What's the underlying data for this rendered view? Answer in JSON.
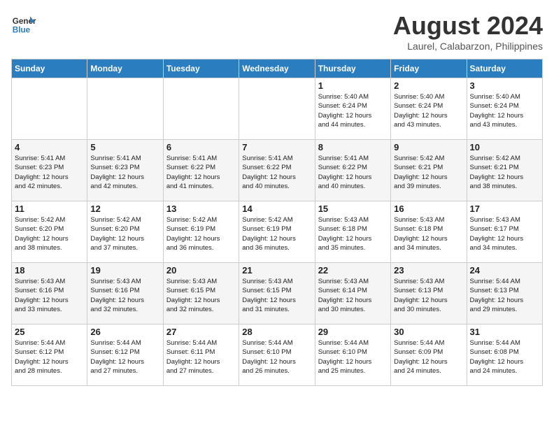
{
  "header": {
    "logo_line1": "General",
    "logo_line2": "Blue",
    "month_year": "August 2024",
    "location": "Laurel, Calabarzon, Philippines"
  },
  "weekdays": [
    "Sunday",
    "Monday",
    "Tuesday",
    "Wednesday",
    "Thursday",
    "Friday",
    "Saturday"
  ],
  "weeks": [
    [
      {
        "day": "",
        "info": ""
      },
      {
        "day": "",
        "info": ""
      },
      {
        "day": "",
        "info": ""
      },
      {
        "day": "",
        "info": ""
      },
      {
        "day": "1",
        "info": "Sunrise: 5:40 AM\nSunset: 6:24 PM\nDaylight: 12 hours\nand 44 minutes."
      },
      {
        "day": "2",
        "info": "Sunrise: 5:40 AM\nSunset: 6:24 PM\nDaylight: 12 hours\nand 43 minutes."
      },
      {
        "day": "3",
        "info": "Sunrise: 5:40 AM\nSunset: 6:24 PM\nDaylight: 12 hours\nand 43 minutes."
      }
    ],
    [
      {
        "day": "4",
        "info": "Sunrise: 5:41 AM\nSunset: 6:23 PM\nDaylight: 12 hours\nand 42 minutes."
      },
      {
        "day": "5",
        "info": "Sunrise: 5:41 AM\nSunset: 6:23 PM\nDaylight: 12 hours\nand 42 minutes."
      },
      {
        "day": "6",
        "info": "Sunrise: 5:41 AM\nSunset: 6:22 PM\nDaylight: 12 hours\nand 41 minutes."
      },
      {
        "day": "7",
        "info": "Sunrise: 5:41 AM\nSunset: 6:22 PM\nDaylight: 12 hours\nand 40 minutes."
      },
      {
        "day": "8",
        "info": "Sunrise: 5:41 AM\nSunset: 6:22 PM\nDaylight: 12 hours\nand 40 minutes."
      },
      {
        "day": "9",
        "info": "Sunrise: 5:42 AM\nSunset: 6:21 PM\nDaylight: 12 hours\nand 39 minutes."
      },
      {
        "day": "10",
        "info": "Sunrise: 5:42 AM\nSunset: 6:21 PM\nDaylight: 12 hours\nand 38 minutes."
      }
    ],
    [
      {
        "day": "11",
        "info": "Sunrise: 5:42 AM\nSunset: 6:20 PM\nDaylight: 12 hours\nand 38 minutes."
      },
      {
        "day": "12",
        "info": "Sunrise: 5:42 AM\nSunset: 6:20 PM\nDaylight: 12 hours\nand 37 minutes."
      },
      {
        "day": "13",
        "info": "Sunrise: 5:42 AM\nSunset: 6:19 PM\nDaylight: 12 hours\nand 36 minutes."
      },
      {
        "day": "14",
        "info": "Sunrise: 5:42 AM\nSunset: 6:19 PM\nDaylight: 12 hours\nand 36 minutes."
      },
      {
        "day": "15",
        "info": "Sunrise: 5:43 AM\nSunset: 6:18 PM\nDaylight: 12 hours\nand 35 minutes."
      },
      {
        "day": "16",
        "info": "Sunrise: 5:43 AM\nSunset: 6:18 PM\nDaylight: 12 hours\nand 34 minutes."
      },
      {
        "day": "17",
        "info": "Sunrise: 5:43 AM\nSunset: 6:17 PM\nDaylight: 12 hours\nand 34 minutes."
      }
    ],
    [
      {
        "day": "18",
        "info": "Sunrise: 5:43 AM\nSunset: 6:16 PM\nDaylight: 12 hours\nand 33 minutes."
      },
      {
        "day": "19",
        "info": "Sunrise: 5:43 AM\nSunset: 6:16 PM\nDaylight: 12 hours\nand 32 minutes."
      },
      {
        "day": "20",
        "info": "Sunrise: 5:43 AM\nSunset: 6:15 PM\nDaylight: 12 hours\nand 32 minutes."
      },
      {
        "day": "21",
        "info": "Sunrise: 5:43 AM\nSunset: 6:15 PM\nDaylight: 12 hours\nand 31 minutes."
      },
      {
        "day": "22",
        "info": "Sunrise: 5:43 AM\nSunset: 6:14 PM\nDaylight: 12 hours\nand 30 minutes."
      },
      {
        "day": "23",
        "info": "Sunrise: 5:43 AM\nSunset: 6:13 PM\nDaylight: 12 hours\nand 30 minutes."
      },
      {
        "day": "24",
        "info": "Sunrise: 5:44 AM\nSunset: 6:13 PM\nDaylight: 12 hours\nand 29 minutes."
      }
    ],
    [
      {
        "day": "25",
        "info": "Sunrise: 5:44 AM\nSunset: 6:12 PM\nDaylight: 12 hours\nand 28 minutes."
      },
      {
        "day": "26",
        "info": "Sunrise: 5:44 AM\nSunset: 6:12 PM\nDaylight: 12 hours\nand 27 minutes."
      },
      {
        "day": "27",
        "info": "Sunrise: 5:44 AM\nSunset: 6:11 PM\nDaylight: 12 hours\nand 27 minutes."
      },
      {
        "day": "28",
        "info": "Sunrise: 5:44 AM\nSunset: 6:10 PM\nDaylight: 12 hours\nand 26 minutes."
      },
      {
        "day": "29",
        "info": "Sunrise: 5:44 AM\nSunset: 6:10 PM\nDaylight: 12 hours\nand 25 minutes."
      },
      {
        "day": "30",
        "info": "Sunrise: 5:44 AM\nSunset: 6:09 PM\nDaylight: 12 hours\nand 24 minutes."
      },
      {
        "day": "31",
        "info": "Sunrise: 5:44 AM\nSunset: 6:08 PM\nDaylight: 12 hours\nand 24 minutes."
      }
    ]
  ]
}
